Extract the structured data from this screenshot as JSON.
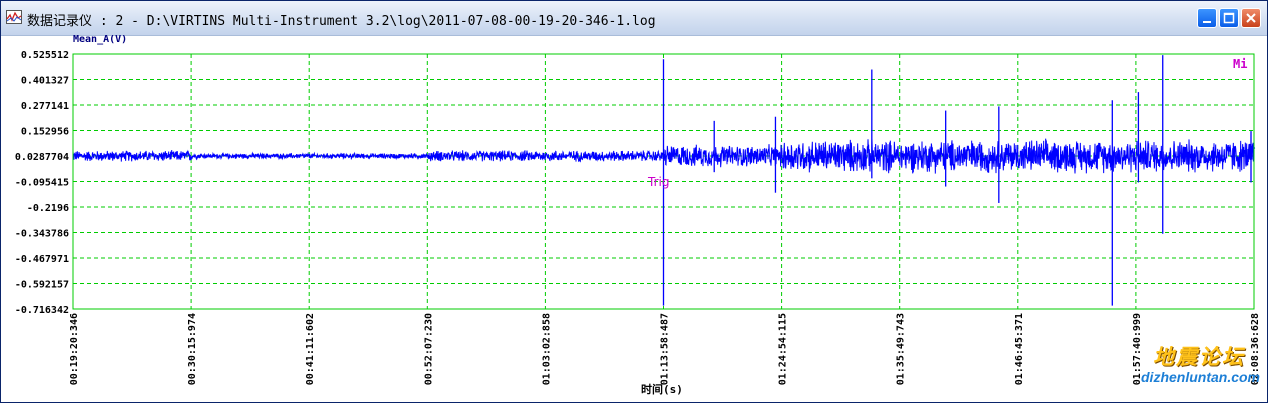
{
  "window": {
    "title": "数据记录仪 : 2 - D:\\VIRTINS Multi-Instrument 3.2\\log\\2011-07-08-00-19-20-346-1.log",
    "icons": [
      "app-chart-icon",
      "minimize-icon",
      "maximize-icon",
      "close-icon"
    ]
  },
  "chart_data": {
    "type": "line",
    "series": [
      {
        "name": "Mean_A(V)",
        "color": "#0000ff"
      }
    ],
    "ylabel": "Mean_A(V)",
    "xlabel": "时间(s)",
    "ylim": [
      -0.716342,
      0.525512
    ],
    "y_ticks": [
      "0.525512",
      "0.401327",
      "0.277141",
      "0.152956",
      "0.0287704",
      "-0.095415",
      "-0.2196",
      "-0.343786",
      "-0.467971",
      "-0.592157",
      "-0.716342"
    ],
    "x_ticks": [
      "00:19:20:346",
      "00:30:15:974",
      "00:41:11:602",
      "00:52:07:230",
      "01:03:02:858",
      "01:13:58:487",
      "01:24:54:115",
      "01:35:49:743",
      "01:46:45:371",
      "01:57:40:999",
      "02:08:36:628"
    ],
    "grid": true,
    "grid_color": "#00cc00",
    "axes_color": "#00cc00",
    "annotations": [
      {
        "text": "Trig",
        "color": "#cc00cc",
        "x": "01:13:58:487"
      },
      {
        "text": "Mi",
        "color": "#cc00cc",
        "position": "top-right"
      }
    ],
    "signal_profile": {
      "baseline": 0.0288,
      "envelopes": [
        {
          "from": "00:19:20:346",
          "to": "00:30:15:974",
          "amplitude": 0.03
        },
        {
          "from": "00:30:15:974",
          "to": "00:52:07:230",
          "amplitude": 0.015
        },
        {
          "from": "00:52:07:230",
          "to": "01:13:58:487",
          "amplitude": 0.03
        },
        {
          "from": "01:13:58:487",
          "to": "01:24:54:115",
          "amplitude": 0.06
        },
        {
          "from": "01:24:54:115",
          "to": "02:08:36:628",
          "amplitude": 0.09
        }
      ],
      "spikes": [
        {
          "x": "01:13:58:487",
          "max": 0.5,
          "min": -0.7
        },
        {
          "x": "01:18:40:000",
          "max": 0.2,
          "min": -0.05
        },
        {
          "x": "01:24:20:000",
          "max": 0.22,
          "min": -0.15
        },
        {
          "x": "01:33:15:000",
          "max": 0.45,
          "min": -0.08
        },
        {
          "x": "01:40:05:000",
          "max": 0.25,
          "min": -0.12
        },
        {
          "x": "01:45:00:000",
          "max": 0.27,
          "min": -0.2
        },
        {
          "x": "01:55:30:000",
          "max": 0.3,
          "min": -0.7
        },
        {
          "x": "01:57:55:000",
          "max": 0.34,
          "min": -0.1
        },
        {
          "x": "02:00:10:000",
          "max": 0.52,
          "min": -0.35
        },
        {
          "x": "02:08:20:000",
          "max": 0.15,
          "min": -0.1
        }
      ]
    }
  },
  "watermark": {
    "line1": "地震论坛",
    "line2": "dizhenluntan.com"
  }
}
